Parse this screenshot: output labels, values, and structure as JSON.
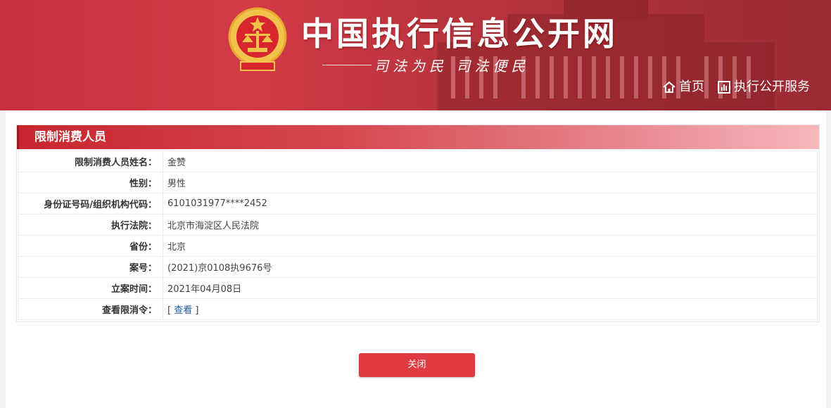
{
  "header": {
    "site_title": "中国执行信息公开网",
    "slogan": "司法为民  司法便民",
    "nav": [
      {
        "label": "首页",
        "icon": "home-icon"
      },
      {
        "label": "执行公开服务",
        "icon": "chart-icon"
      }
    ]
  },
  "section": {
    "title": "限制消费人员"
  },
  "rows": [
    {
      "label": "限制消费人员姓名：",
      "value": "金赞"
    },
    {
      "label": "性别：",
      "value": "男性"
    },
    {
      "label": "身份证号码/组织机构代码：",
      "value": "6101031977****2452"
    },
    {
      "label": "执行法院：",
      "value": "北京市海淀区人民法院"
    },
    {
      "label": "省份：",
      "value": "北京"
    },
    {
      "label": "案号：",
      "value": "(2021)京0108执9676号"
    },
    {
      "label": "立案时间：",
      "value": "2021年04月08日"
    },
    {
      "label": "查看限消令：",
      "value_prefix": "[ ",
      "link": "查看",
      "value_suffix": " ]"
    }
  ],
  "close_button": "关闭",
  "colors": {
    "header_red": "#c8323f",
    "title_bar_red": "#c8262f",
    "button_red": "#e03b43",
    "link_blue": "#1d5ba8"
  }
}
